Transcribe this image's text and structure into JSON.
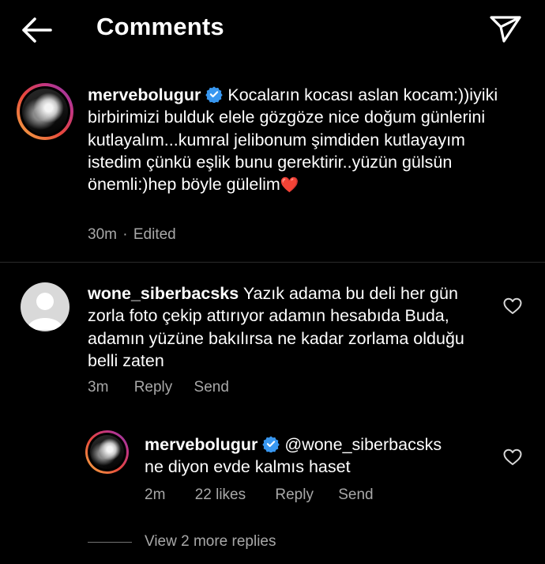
{
  "header": {
    "title": "Comments"
  },
  "caption": {
    "username": "mervebolugur",
    "text": "Kocaların kocası aslan kocam:))iyiki birbirimizi bulduk elele gözgöze nice doğum günlerini kutlayalım...kumral jelibonum şimdiden kutlayayım istedim çünkü eşlik bunu gerektirir..yüzün gülsün önemli:)hep böyle gülelim",
    "emoji": "❤️",
    "time": "30m",
    "separator": "·",
    "status": "Edited"
  },
  "comments": [
    {
      "username": "wone_siberbacsks",
      "text": "Yazık adama bu deli her gün zorla foto çekip attırıyor adamın hesabıda Buda, adamın yüzüne bakılırsa ne kadar zorlama olduğu belli zaten",
      "time": "3m",
      "reply_label": "Reply",
      "send_label": "Send",
      "replies": [
        {
          "username": "mervebolugur",
          "mention": "@wone_siberbacsks",
          "text": "ne diyon evde kalmıs haset",
          "time": "2m",
          "likes": "22 likes",
          "reply_label": "Reply",
          "send_label": "Send"
        }
      ],
      "view_more_label": "View 2 more replies"
    }
  ],
  "colors": {
    "background": "#000000",
    "text": "#ffffff",
    "meta": "#a8a8a8",
    "verified": "#3897f0",
    "heart_emoji": "#e0245e"
  }
}
